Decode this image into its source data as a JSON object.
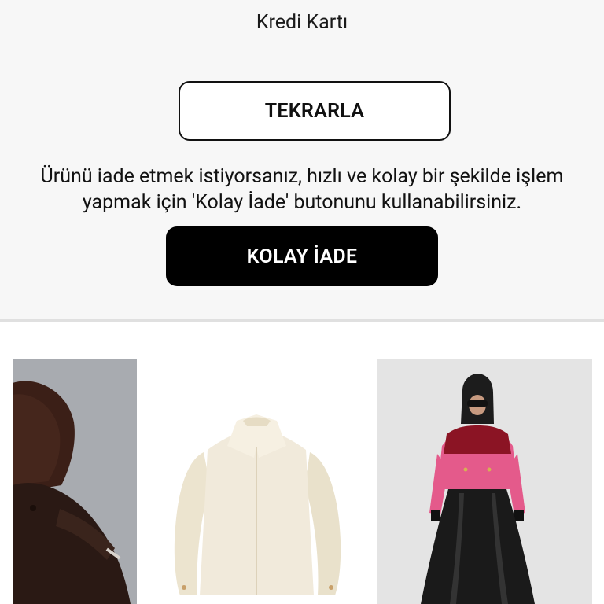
{
  "payment": {
    "method_label": "Kredi Kartı"
  },
  "actions": {
    "retry_label": "TEKRARLA",
    "easy_return_label": "KOLAY İADE"
  },
  "return_info": {
    "line1": "Ürünü iade etmek istiyorsanız, hızlı ve kolay bir şekilde işlem",
    "line2": "yapmak için 'Kolay İade' butonunu kullanabilirsiniz."
  },
  "products": [
    {
      "icon": "product-photo-hijab-model-brown-coat"
    },
    {
      "icon": "product-photo-cream-cropped-shirt"
    },
    {
      "icon": "product-photo-model-pink-red-jacket"
    }
  ]
}
